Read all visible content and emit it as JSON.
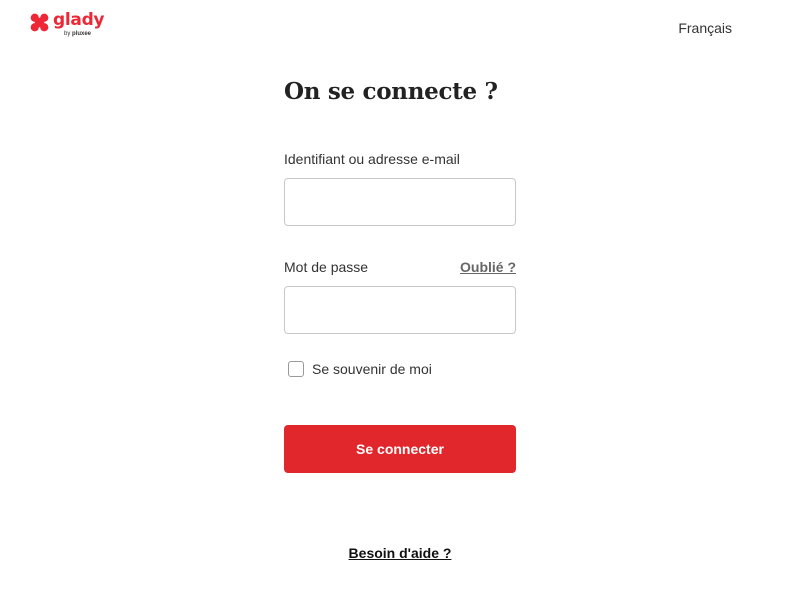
{
  "brand": {
    "name": "glady",
    "tagline_prefix": "by",
    "tagline_brand": "pluxee",
    "color": "#ee2737"
  },
  "header": {
    "language": "Français"
  },
  "login": {
    "title": "On se connecte ?",
    "email_label": "Identifiant ou adresse e-mail",
    "email_value": "",
    "password_label": "Mot de passe",
    "password_value": "",
    "forgot_link": "Oublié ?",
    "remember_label": "Se souvenir de moi",
    "remember_checked": false,
    "submit_label": "Se connecter",
    "submit_color": "#e1272b"
  },
  "footer": {
    "help_link": "Besoin d'aide ?"
  }
}
